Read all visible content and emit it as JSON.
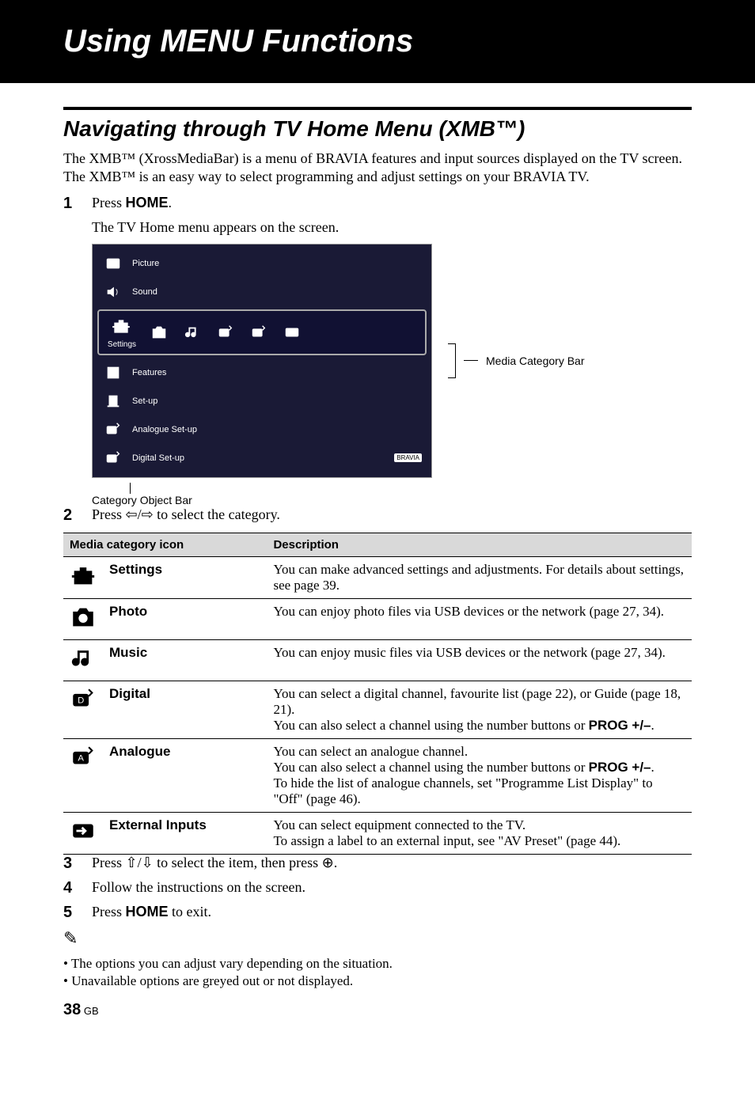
{
  "banner_title": "Using MENU Functions",
  "section_title": "Navigating through TV Home Menu (XMB™)",
  "intro": "The XMB™ (XrossMediaBar) is a menu of BRAVIA features and input sources displayed on the TV screen. The XMB™ is an easy way to select programming and adjust settings on your BRAVIA TV.",
  "step1_num": "1",
  "step1_text_a": "Press ",
  "step1_text_b": "HOME",
  "step1_text_c": ".",
  "step1_sub": "The TV Home menu appears on the screen.",
  "xmb": {
    "picture": "Picture",
    "sound": "Sound",
    "settings": "Settings",
    "features": "Features",
    "setup": "Set-up",
    "analogue_setup": "Analogue Set-up",
    "digital_setup": "Digital Set-up",
    "bravia": "BRAVIA"
  },
  "media_bar_label": "Media Category Bar",
  "category_bar_label": "Category Object Bar",
  "step2_num": "2",
  "step2_text": "Press ⇦/⇨ to select the category.",
  "table": {
    "header_icon": "Media category icon",
    "header_desc": "Description",
    "rows": [
      {
        "name": "Settings",
        "desc": "You can make advanced settings and adjustments. For details about settings, see page 39."
      },
      {
        "name": "Photo",
        "desc": "You can enjoy photo files via USB devices or the network (page 27, 34)."
      },
      {
        "name": "Music",
        "desc": "You can enjoy music files via USB devices or the network (page 27, 34)."
      },
      {
        "name": "Digital",
        "desc": "You can select a digital channel, favourite list (page 22), or Guide (page 18, 21).\nYou can also select a channel using the number buttons or PROG +/–."
      },
      {
        "name": "Analogue",
        "desc": "You can select an analogue channel.\nYou can also select a channel using the number buttons or PROG +/–.\nTo hide the list of analogue channels, set \"Programme List Display\" to \"Off\" (page 46)."
      },
      {
        "name": "External Inputs",
        "desc": "You can select equipment connected to the TV.\nTo assign a label to an external input, see \"AV Preset\" (page 44)."
      }
    ]
  },
  "step3_num": "3",
  "step3_text": "Press ⇧/⇩ to select the item, then press ⊕.",
  "step4_num": "4",
  "step4_text": "Follow the instructions on the screen.",
  "step5_num": "5",
  "step5_text_a": "Press ",
  "step5_text_b": "HOME",
  "step5_text_c": " to exit.",
  "note_icon": "✎",
  "notes": [
    "• The options you can adjust vary depending on the situation.",
    "• Unavailable options are greyed out or not displayed."
  ],
  "page_num": "38",
  "page_region": " GB"
}
